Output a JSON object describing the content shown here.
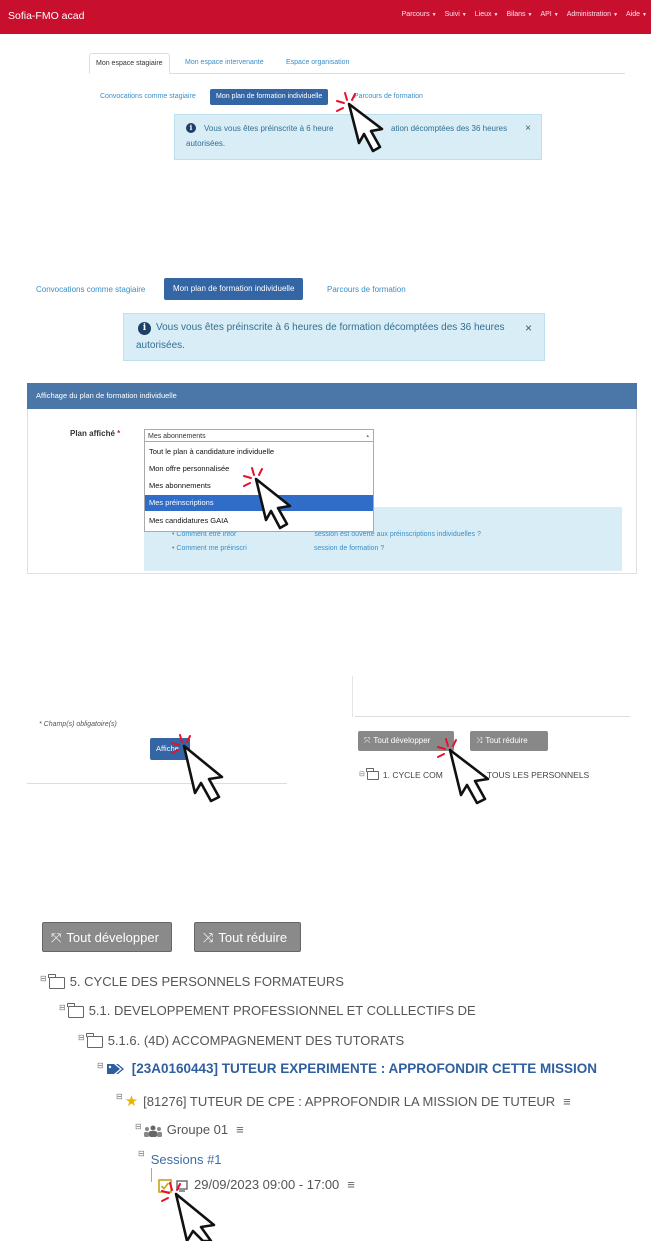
{
  "navbar": {
    "brand": "Sofia-FMO acad",
    "menu": [
      "Parcours",
      "Suivi",
      "Lieux",
      "Bilans",
      "API",
      "Administration",
      "Aide"
    ]
  },
  "tabs": {
    "stagiaire": "Mon espace stagiaire",
    "intervenante": "Mon espace intervenante",
    "organisation": "Espace organisation"
  },
  "subtabs": {
    "convocations": "Convocations comme stagiaire",
    "plan": "Mon plan de formation individuelle",
    "parcours": "Parcours de formation"
  },
  "alert": {
    "text_prefix": "Vous vous êtes préinscrite à 6 heure",
    "text_suffix": "ation décomptées des 36 heures",
    "text_full": "Vous vous êtes préinscrite à 6 heures de formation décomptées des 36 heures",
    "line2": "autorisées.",
    "close": "×",
    "info_symbol": "i"
  },
  "form": {
    "panel_title": "Affichage du plan de formation individuelle",
    "plan_label": "Plan affiché",
    "required_mark": "*",
    "selected_value": "Mes abonnements",
    "select_caret": "▴",
    "options": [
      "Tout le plan à candidature individuelle",
      "Mon offre personnalisée",
      "Mes abonnements",
      "Mes préinscriptions",
      "Mes candidatures GAIA"
    ],
    "highlighted_index": 3,
    "help_links": [
      "Comment être infor",
      "session est ouverte aux préinscriptions individuelles ?",
      "Comment me préinscri",
      "session de formation ?"
    ],
    "required_note": "* Champ(s) obligatoire(s)",
    "submit": "Affiche"
  },
  "tree_buttons": {
    "expand": "Tout développer",
    "collapse": "Tout réduire"
  },
  "tree_small": {
    "label_a": "1. CYCLE COM",
    "label_b": "TOUS LES PERSONNELS"
  },
  "tree": {
    "items": [
      "5. CYCLE DES PERSONNELS FORMATEURS",
      "5.1. DEVELOPPEMENT PROFESSIONNEL ET COLLLECTIFS DE",
      "5.1.6. (4D) ACCOMPAGNEMENT DES TUTORATS",
      "[23A0160443] TUTEUR EXPERIMENTE : APPROFONDIR CETTE MISSION",
      "[81276] TUTEUR DE CPE : APPROFONDIR LA MISSION DE TUTEUR",
      "Groupe 01",
      "Sessions #1",
      "29/09/2023 09:00 - 17:00"
    ],
    "menu_symbol": "≡",
    "toggle_symbol": "⊟"
  },
  "colors": {
    "navbar": "#c8102e",
    "primary": "#3465a4",
    "link": "#3a8fc7",
    "alert_bg": "#d9edf7",
    "tree_module": "#2f5f9e",
    "star": "#e8b400",
    "checkbox": "#c8a020"
  }
}
